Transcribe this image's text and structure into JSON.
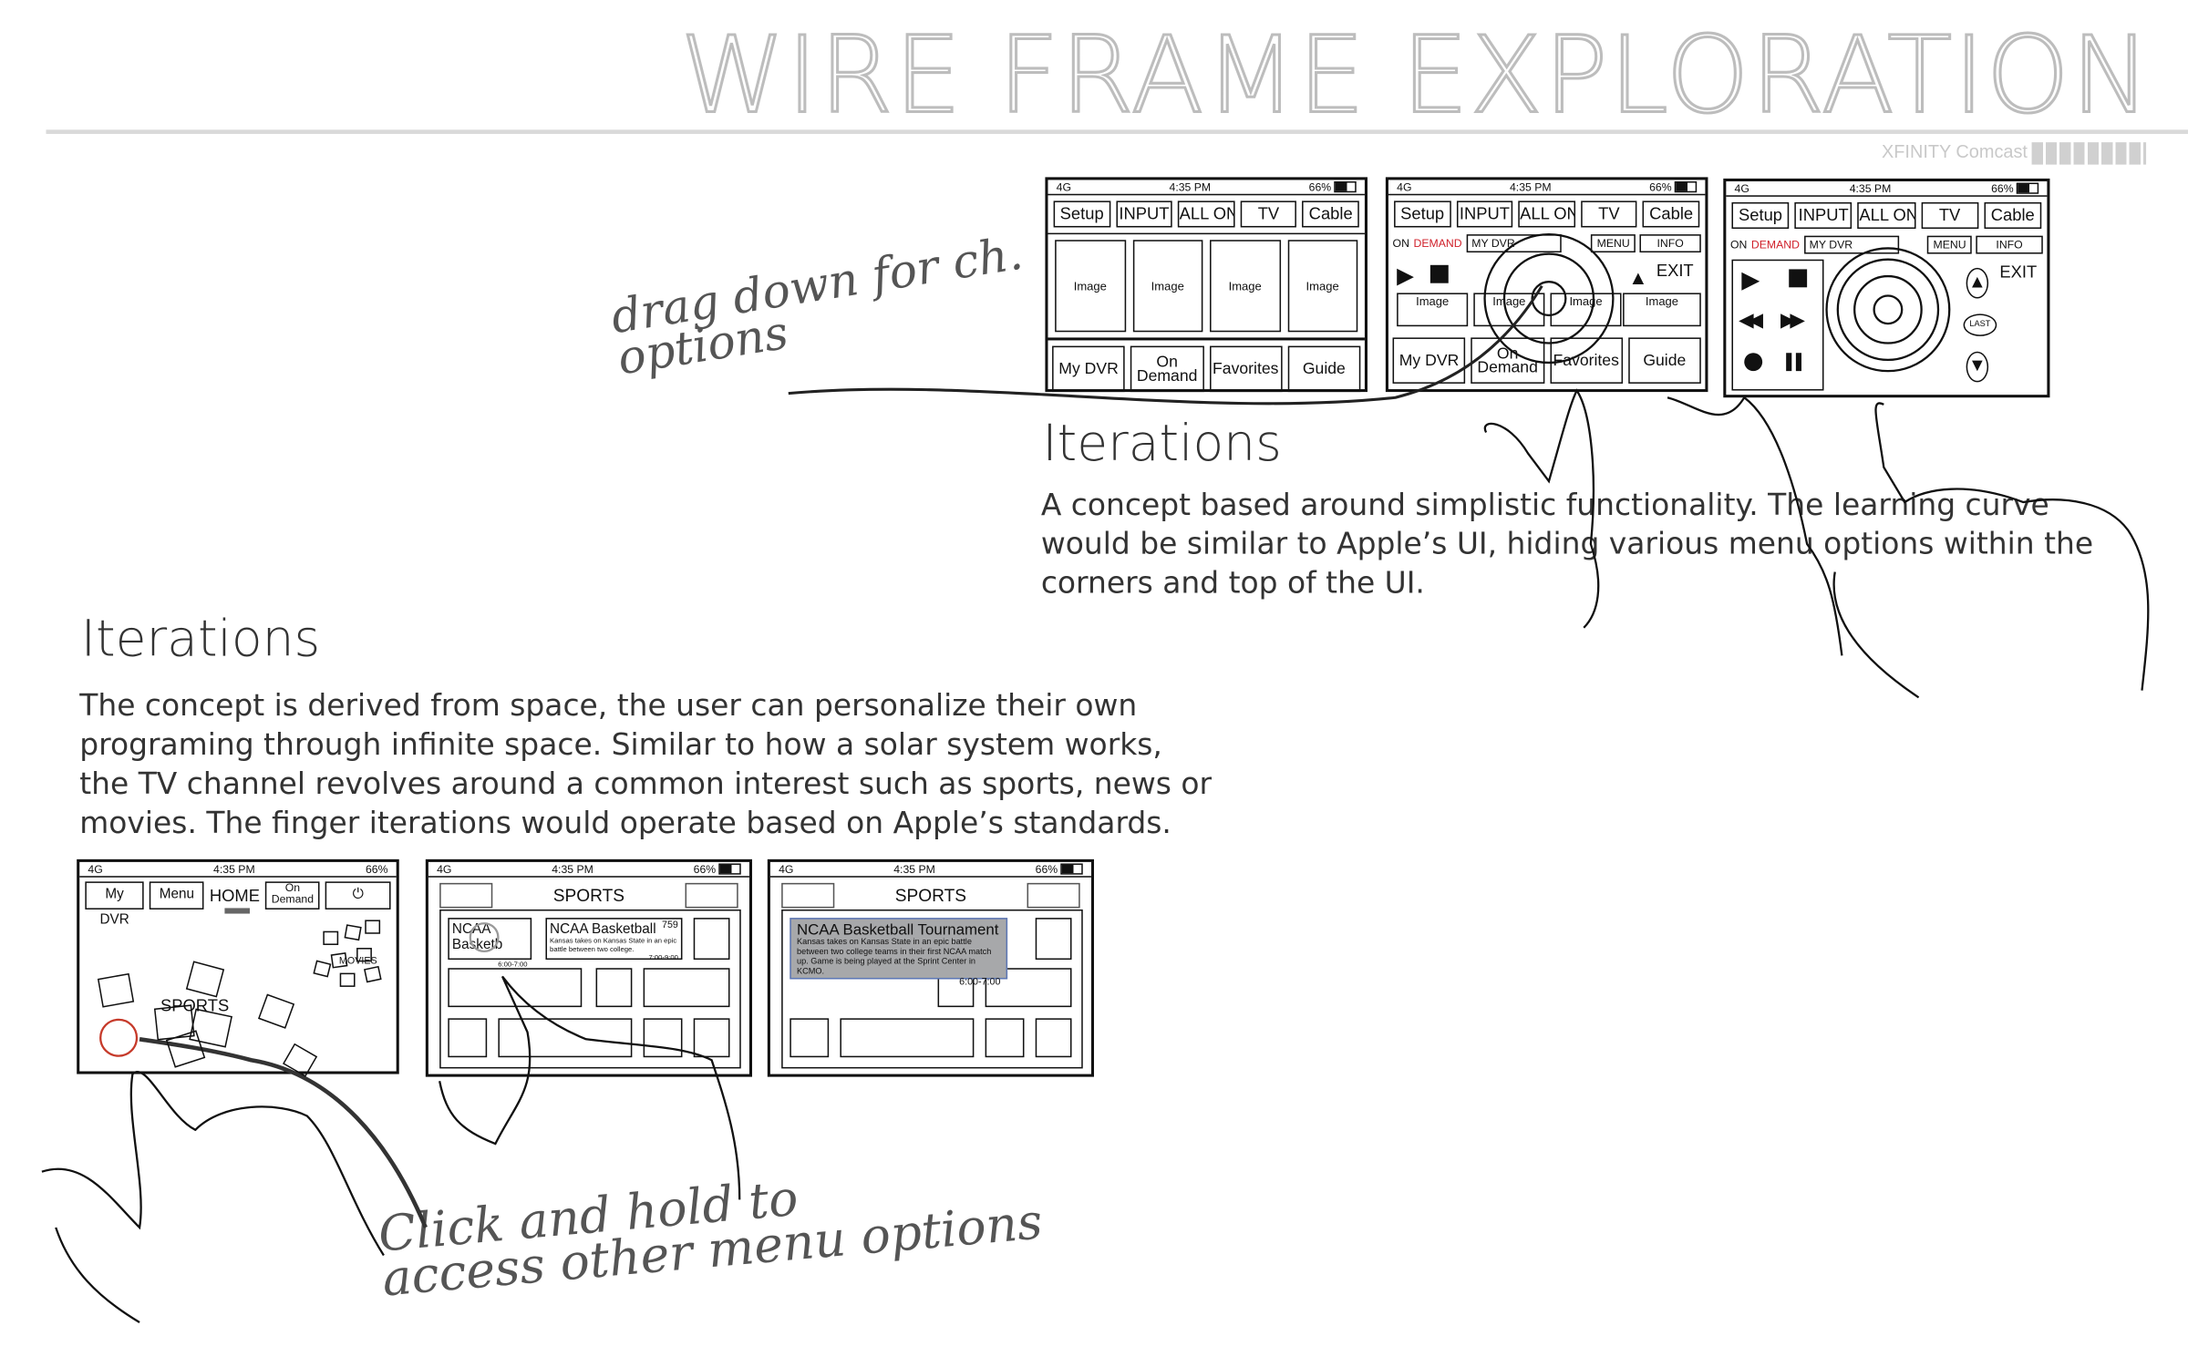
{
  "header": {
    "title": "WIRE FRAME EXPLORATION",
    "brand": "XFINITY Comcast"
  },
  "iterations_right": {
    "heading": "Iterations",
    "lines": [
      "A concept based around simplistic functionality. The learning curve",
      "would be similar to Apple’s UI, hiding various menu options within the",
      "corners and top of the UI."
    ]
  },
  "iterations_left": {
    "heading": "Iterations",
    "lines": [
      "The concept is derived from space, the user can personalize their own",
      "programing through infinite space. Similar to how a solar system works,",
      "the TV channel revolves around a common interest such as sports, news or",
      "movies.  The finger iterations would operate based on Apple’s standards."
    ]
  },
  "annotations": {
    "drag_line1": "drag down for ch.",
    "drag_line2": "options",
    "click_line1": "Click and hold to",
    "click_line2": "access other menu options"
  },
  "status": {
    "signal": "4G",
    "time": "4:35 PM",
    "battery": "66%"
  },
  "remote": {
    "top_buttons": [
      "Setup",
      "INPUT",
      "ALL ON",
      "TV",
      "Cable"
    ],
    "tiles": [
      "Image",
      "Image",
      "Image",
      "Image"
    ],
    "bottom_buttons": [
      "My DVR",
      "On Demand",
      "Favorites",
      "Guide"
    ],
    "on": "ON",
    "demand": "DEMAND",
    "mydvr": "MY DVR",
    "menu": "MENU",
    "info": "INFO",
    "exit": "EXIT",
    "last": "LAST"
  },
  "space_ui": {
    "my_dvr": "My DVR",
    "menu": "Menu",
    "home": "HOME",
    "on_demand": "On Demand",
    "sports": "SPORTS",
    "movies": "MOVIES"
  },
  "sports_ui": {
    "title": "SPORTS",
    "card1": "NCAA Basketb",
    "card1_time": "6:00-7:00",
    "card2_title": "NCAA Basketball",
    "card2_channel": "759",
    "card2_desc": "Kansas takes on Kansas State in an epic battle between two college.",
    "card2_time": "7:00-9:00",
    "popup_title": "NCAA Basketball Tournament",
    "popup_desc": "Kansas takes on Kansas State in an epic battle between two college teams in their first NCAA match up. Game is being played at the Sprint Center in KCMO.",
    "popup_time": "6:00-7:00"
  },
  "colors": {
    "title_outline": "#bdbdbd",
    "accent_red": "#d0202a",
    "popup_bg": "#a7a8aa",
    "popup_border": "#5d77b5"
  }
}
